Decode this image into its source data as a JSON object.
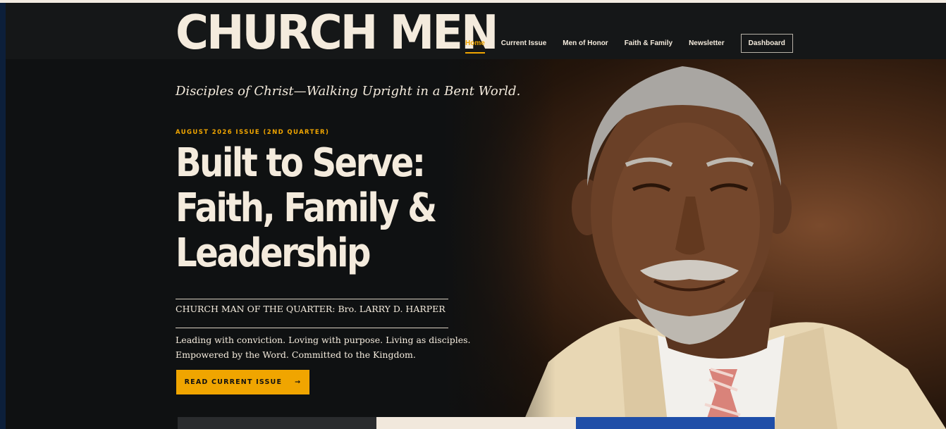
{
  "brand": {
    "name": "CHURCH MEN"
  },
  "nav": {
    "items": [
      {
        "label": "Home",
        "active": true
      },
      {
        "label": "Current Issue",
        "active": false
      },
      {
        "label": "Men of Honor",
        "active": false
      },
      {
        "label": "Faith & Family",
        "active": false
      },
      {
        "label": "Newsletter",
        "active": false
      }
    ],
    "dashboard_label": "Dashboard"
  },
  "hero": {
    "tagline": "Disciples of Christ—Walking Upright in a Bent World.",
    "issue_label": "AUGUST 2026 ISSUE (2ND QUARTER)",
    "headline_lines": [
      "Built to Serve:",
      "Faith, Family &",
      "Leadership"
    ],
    "feature": "CHURCH MAN OF THE QUARTER: Bro. LARRY D. HARPER",
    "description_lines": [
      "Leading with conviction. Loving with purpose. Living as disciples.",
      "Empowered by the Word. Committed to the Kingdom."
    ],
    "cta_label": "READ CURRENT ISSUE",
    "cta_arrow": "→"
  },
  "colors": {
    "accent": "#f0a500",
    "cream": "#f4ebdd",
    "background": "#0f1112",
    "header": "#151718",
    "bottom_bars": [
      "#2a2c2e",
      "#f1e8dc",
      "#1f4ea8"
    ]
  }
}
